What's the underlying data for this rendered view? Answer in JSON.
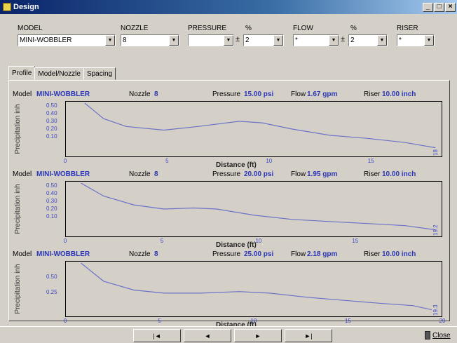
{
  "window": {
    "title": "Design",
    "min": "_",
    "max": "□",
    "close": "×"
  },
  "controls": {
    "model_label": "MODEL",
    "model_value": "MINI-WOBBLER",
    "nozzle_label": "NOZZLE",
    "nozzle_value": "8",
    "pressure_label": "PRESSURE",
    "pressure_pct_label": "%",
    "pressure_value": "",
    "pressure_pm": "±",
    "pressure_pct_value": "2",
    "flow_label": "FLOW",
    "flow_pct_label": "%",
    "flow_value": "*",
    "flow_pm": "±",
    "flow_pct_value": "2",
    "riser_label": "RISER",
    "riser_value": "*"
  },
  "tabs": [
    "Profile",
    "Model/Nozzle",
    "Spacing"
  ],
  "graphs": [
    {
      "model_label": "Model",
      "model": "MINI-WOBBLER",
      "nozzle_label": "Nozzle",
      "nozzle": "8",
      "pressure_label": "Pressure",
      "pressure": "15.00 psi",
      "flow_label": "Flow",
      "flow": "1.67 gpm",
      "riser_label": "Riser",
      "riser": "10.00 inch",
      "ylabel": "Precipitation inh",
      "yticks": [
        "0.50",
        "0.40",
        "0.30",
        "0.20",
        "0.10"
      ],
      "xticks": [
        "0",
        "5",
        "10",
        "15"
      ],
      "xlabel": "Distance (ft)",
      "end_label": "18"
    },
    {
      "model_label": "Model",
      "model": "MINI-WOBBLER",
      "nozzle_label": "Nozzle",
      "nozzle": "8",
      "pressure_label": "Pressure",
      "pressure": "20.00 psi",
      "flow_label": "Flow",
      "flow": "1.95 gpm",
      "riser_label": "Riser",
      "riser": "10.00 inch",
      "ylabel": "Precipitation inh",
      "yticks": [
        "0.50",
        "0.40",
        "0.30",
        "0.20",
        "0.10"
      ],
      "xticks": [
        "0",
        "5",
        "10",
        "15"
      ],
      "xlabel": "Distance (ft)",
      "end_label": "19.2"
    },
    {
      "model_label": "Model",
      "model": "MINI-WOBBLER",
      "nozzle_label": "Nozzle",
      "nozzle": "8",
      "pressure_label": "Pressure",
      "pressure": "25.00 psi",
      "flow_label": "Flow",
      "flow": "2.18 gpm",
      "riser_label": "Riser",
      "riser": "10.00 inch",
      "ylabel": "Precipitation inh",
      "yticks": [
        "0.50",
        "0.25"
      ],
      "xticks": [
        "0",
        "5",
        "10",
        "15",
        "20"
      ],
      "xlabel": "Distance (ft)",
      "end_label": "19.3"
    }
  ],
  "nav": {
    "first": "|◄",
    "prev": "◄",
    "next": "►",
    "last": "►|",
    "close": "Close"
  },
  "colors": {
    "curve": "#6c72c8",
    "accent": "#2a36b8",
    "titlebar": "#0a246a"
  }
}
